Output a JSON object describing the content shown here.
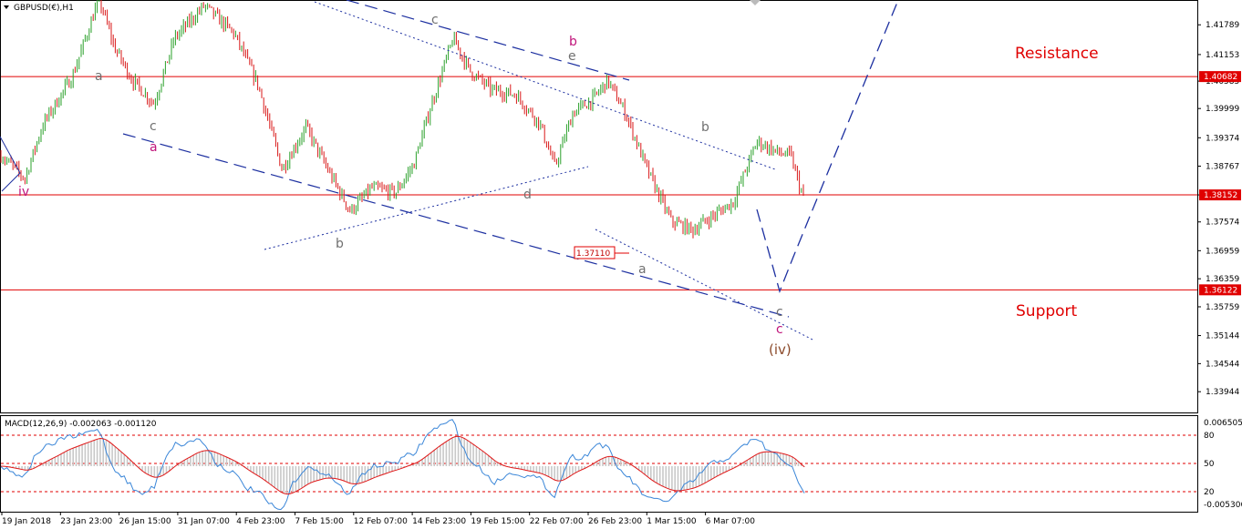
{
  "header": {
    "symbol": "GBPUSD(€),H1",
    "macd_label": "MACD(12,26,9) -0.002063 -0.001120"
  },
  "colors": {
    "bull": "#2aa02a",
    "bear": "#d81818",
    "level": "#e00000",
    "wave": "#1c2fa0",
    "gray": "#707070",
    "magenta": "#c0147a",
    "brown": "#8b4a2a",
    "macd_line": "#3a86d8",
    "signal_line": "#e01818",
    "hist": "#c8c8c8"
  },
  "chart_data": [
    {
      "type": "candlestick",
      "timeframe": "H1",
      "ylim": [
        1.335,
        1.423
      ],
      "y_ticks": [
        "1.41789",
        "1.41153",
        "1.40585",
        "1.39999",
        "1.39374",
        "1.38767",
        "1.38152",
        "1.37574",
        "1.36959",
        "1.36359",
        "1.35759",
        "1.35144",
        "1.34544",
        "1.33944"
      ],
      "x_ticks": [
        "19 Jan 2018",
        "23 Jan 23:00",
        "26 Jan 15:00",
        "31 Jan 07:00",
        "4 Feb 23:00",
        "7 Feb 15:00",
        "12 Feb 07:00",
        "14 Feb 23:00",
        "19 Feb 15:00",
        "22 Feb 07:00",
        "26 Feb 23:00",
        "1 Mar 15:00",
        "6 Mar 07:00"
      ],
      "price_path": [
        {
          "t": 0.0,
          "p": 1.39
        },
        {
          "t": 0.02,
          "p": 1.385
        },
        {
          "t": 0.035,
          "p": 1.3965
        },
        {
          "t": 0.06,
          "p": 1.407
        },
        {
          "t": 0.082,
          "p": 1.4235
        },
        {
          "t": 0.095,
          "p": 1.413
        },
        {
          "t": 0.11,
          "p": 1.406
        },
        {
          "t": 0.128,
          "p": 1.401
        },
        {
          "t": 0.145,
          "p": 1.415
        },
        {
          "t": 0.17,
          "p": 1.422
        },
        {
          "t": 0.195,
          "p": 1.416
        },
        {
          "t": 0.215,
          "p": 1.405
        },
        {
          "t": 0.235,
          "p": 1.387
        },
        {
          "t": 0.255,
          "p": 1.396
        },
        {
          "t": 0.275,
          "p": 1.386
        },
        {
          "t": 0.292,
          "p": 1.378
        },
        {
          "t": 0.31,
          "p": 1.383
        },
        {
          "t": 0.33,
          "p": 1.382
        },
        {
          "t": 0.345,
          "p": 1.388
        },
        {
          "t": 0.36,
          "p": 1.401
        },
        {
          "t": 0.378,
          "p": 1.415
        },
        {
          "t": 0.392,
          "p": 1.408
        },
        {
          "t": 0.41,
          "p": 1.404
        },
        {
          "t": 0.43,
          "p": 1.403
        },
        {
          "t": 0.45,
          "p": 1.397
        },
        {
          "t": 0.463,
          "p": 1.3875
        },
        {
          "t": 0.478,
          "p": 1.399
        },
        {
          "t": 0.495,
          "p": 1.402
        },
        {
          "t": 0.507,
          "p": 1.406
        },
        {
          "t": 0.522,
          "p": 1.399
        },
        {
          "t": 0.54,
          "p": 1.387
        },
        {
          "t": 0.56,
          "p": 1.376
        },
        {
          "t": 0.578,
          "p": 1.374
        },
        {
          "t": 0.595,
          "p": 1.377
        },
        {
          "t": 0.612,
          "p": 1.38
        },
        {
          "t": 0.632,
          "p": 1.393
        },
        {
          "t": 0.65,
          "p": 1.3905
        },
        {
          "t": 0.66,
          "p": 1.39
        },
        {
          "t": 0.668,
          "p": 1.383
        },
        {
          "t": 0.672,
          "p": 1.3805
        }
      ],
      "levels": [
        {
          "price": 1.40682,
          "label": "1.40682"
        },
        {
          "price": 1.38152,
          "label": "1.38152"
        },
        {
          "price": 1.36122,
          "label": "1.36122"
        }
      ],
      "annotations": {
        "resistance": "Resistance",
        "support": "Support",
        "price_box": "1.37110",
        "waves": {
          "iv_left": "iv",
          "a_upper": "a",
          "c_upper": "c",
          "a_magenta": "a",
          "b_first": "b",
          "c_top": "c",
          "b_magenta": "b",
          "e_gray": "e",
          "d_gray": "d",
          "a_lower": "a",
          "b_right": "b",
          "c_gray": "c",
          "c_magenta": "c",
          "iv_paren": "(iv)"
        }
      }
    },
    {
      "type": "macd",
      "params": [
        12,
        26,
        9
      ],
      "values": {
        "macd": -0.002063,
        "signal": -0.00112
      },
      "y_ticks": [
        "0.006505",
        "80",
        "50",
        "20",
        "-0.005306"
      ]
    }
  ]
}
